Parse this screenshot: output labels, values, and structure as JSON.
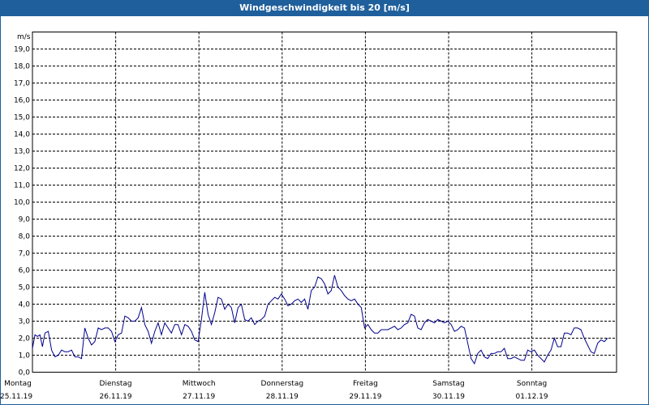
{
  "window": {
    "title_bar_color": "#1f5f9c"
  },
  "chart_data": {
    "type": "line",
    "title": "Windgeschwindigkeit bis 20 [m/s]",
    "ylabel": "m/s",
    "ylim": [
      0,
      20
    ],
    "yticks": [
      "0,0",
      "1,0",
      "2,0",
      "3,0",
      "4,0",
      "5,0",
      "6,0",
      "7,0",
      "8,0",
      "9,0",
      "10,0",
      "11,0",
      "12,0",
      "13,0",
      "14,0",
      "15,0",
      "16,0",
      "17,0",
      "18,0",
      "19,0"
    ],
    "days": [
      {
        "name": "Montag",
        "date": "25.11.19"
      },
      {
        "name": "Dienstag",
        "date": "26.11.19"
      },
      {
        "name": "Mittwoch",
        "date": "27.11.19"
      },
      {
        "name": "Donnerstag",
        "date": "28.11.19"
      },
      {
        "name": "Freitag",
        "date": "29.11.19"
      },
      {
        "name": "Samstag",
        "date": "30.11.19"
      },
      {
        "name": "Sonntag",
        "date": "01.12.19"
      }
    ],
    "grid": true,
    "line_color": "#00008b",
    "x_unit": "days since start of Montag 25.11.19",
    "points": [
      [
        0.0,
        1.4
      ],
      [
        0.03,
        2.2
      ],
      [
        0.06,
        2.1
      ],
      [
        0.09,
        2.2
      ],
      [
        0.12,
        1.5
      ],
      [
        0.15,
        2.3
      ],
      [
        0.19,
        2.4
      ],
      [
        0.23,
        1.3
      ],
      [
        0.27,
        0.9
      ],
      [
        0.31,
        1.0
      ],
      [
        0.35,
        1.3
      ],
      [
        0.39,
        1.2
      ],
      [
        0.43,
        1.2
      ],
      [
        0.47,
        1.3
      ],
      [
        0.51,
        0.9
      ],
      [
        0.55,
        0.9
      ],
      [
        0.59,
        0.8
      ],
      [
        0.63,
        2.6
      ],
      [
        0.67,
        2.0
      ],
      [
        0.71,
        1.6
      ],
      [
        0.75,
        1.8
      ],
      [
        0.79,
        2.6
      ],
      [
        0.83,
        2.5
      ],
      [
        0.87,
        2.6
      ],
      [
        0.91,
        2.6
      ],
      [
        0.95,
        2.4
      ],
      [
        0.99,
        1.8
      ],
      [
        1.03,
        2.2
      ],
      [
        1.07,
        2.3
      ],
      [
        1.11,
        3.3
      ],
      [
        1.15,
        3.2
      ],
      [
        1.19,
        3.0
      ],
      [
        1.23,
        3.0
      ],
      [
        1.27,
        3.2
      ],
      [
        1.31,
        3.8
      ],
      [
        1.35,
        2.8
      ],
      [
        1.39,
        2.4
      ],
      [
        1.43,
        1.7
      ],
      [
        1.47,
        2.4
      ],
      [
        1.51,
        2.9
      ],
      [
        1.55,
        2.2
      ],
      [
        1.59,
        2.9
      ],
      [
        1.63,
        2.6
      ],
      [
        1.67,
        2.3
      ],
      [
        1.71,
        2.8
      ],
      [
        1.75,
        2.8
      ],
      [
        1.79,
        2.2
      ],
      [
        1.83,
        2.8
      ],
      [
        1.87,
        2.7
      ],
      [
        1.91,
        2.4
      ],
      [
        1.95,
        1.9
      ],
      [
        1.99,
        1.8
      ],
      [
        2.03,
        3.1
      ],
      [
        2.07,
        4.7
      ],
      [
        2.11,
        3.4
      ],
      [
        2.15,
        2.8
      ],
      [
        2.19,
        3.5
      ],
      [
        2.23,
        4.4
      ],
      [
        2.27,
        4.3
      ],
      [
        2.31,
        3.7
      ],
      [
        2.35,
        4.0
      ],
      [
        2.39,
        3.8
      ],
      [
        2.43,
        2.9
      ],
      [
        2.47,
        3.8
      ],
      [
        2.51,
        4.0
      ],
      [
        2.55,
        3.1
      ],
      [
        2.59,
        3.0
      ],
      [
        2.63,
        3.2
      ],
      [
        2.67,
        2.8
      ],
      [
        2.71,
        3.0
      ],
      [
        2.75,
        3.1
      ],
      [
        2.79,
        3.3
      ],
      [
        2.83,
        4.0
      ],
      [
        2.87,
        4.2
      ],
      [
        2.91,
        4.4
      ],
      [
        2.95,
        4.3
      ],
      [
        2.99,
        4.6
      ],
      [
        3.03,
        4.3
      ],
      [
        3.07,
        3.9
      ],
      [
        3.11,
        4.0
      ],
      [
        3.15,
        4.2
      ],
      [
        3.19,
        4.3
      ],
      [
        3.23,
        4.1
      ],
      [
        3.27,
        4.3
      ],
      [
        3.31,
        3.7
      ],
      [
        3.35,
        4.8
      ],
      [
        3.39,
        5.0
      ],
      [
        3.43,
        5.6
      ],
      [
        3.47,
        5.5
      ],
      [
        3.51,
        5.2
      ],
      [
        3.55,
        4.6
      ],
      [
        3.59,
        4.8
      ],
      [
        3.63,
        5.7
      ],
      [
        3.67,
        5.0
      ],
      [
        3.71,
        4.8
      ],
      [
        3.75,
        4.5
      ],
      [
        3.79,
        4.3
      ],
      [
        3.83,
        4.2
      ],
      [
        3.87,
        4.3
      ],
      [
        3.91,
        4.0
      ],
      [
        3.95,
        3.8
      ],
      [
        3.99,
        2.6
      ],
      [
        4.03,
        2.8
      ],
      [
        4.07,
        2.5
      ],
      [
        4.11,
        2.3
      ],
      [
        4.15,
        2.3
      ],
      [
        4.19,
        2.5
      ],
      [
        4.23,
        2.5
      ],
      [
        4.27,
        2.5
      ],
      [
        4.31,
        2.6
      ],
      [
        4.35,
        2.7
      ],
      [
        4.39,
        2.5
      ],
      [
        4.43,
        2.6
      ],
      [
        4.47,
        2.8
      ],
      [
        4.51,
        2.9
      ],
      [
        4.55,
        3.4
      ],
      [
        4.59,
        3.3
      ],
      [
        4.63,
        2.6
      ],
      [
        4.67,
        2.5
      ],
      [
        4.71,
        2.9
      ],
      [
        4.75,
        3.1
      ],
      [
        4.79,
        3.0
      ],
      [
        4.83,
        2.9
      ],
      [
        4.87,
        3.1
      ],
      [
        4.91,
        3.0
      ],
      [
        4.95,
        2.9
      ],
      [
        4.99,
        3.0
      ],
      [
        5.03,
        2.8
      ],
      [
        5.07,
        2.4
      ],
      [
        5.11,
        2.5
      ],
      [
        5.15,
        2.7
      ],
      [
        5.19,
        2.6
      ],
      [
        5.23,
        1.7
      ],
      [
        5.27,
        0.8
      ],
      [
        5.31,
        0.5
      ],
      [
        5.35,
        1.1
      ],
      [
        5.39,
        1.3
      ],
      [
        5.43,
        0.9
      ],
      [
        5.47,
        0.8
      ],
      [
        5.51,
        1.1
      ],
      [
        5.55,
        1.1
      ],
      [
        5.59,
        1.2
      ],
      [
        5.63,
        1.2
      ],
      [
        5.67,
        1.4
      ],
      [
        5.71,
        0.8
      ],
      [
        5.75,
        0.8
      ],
      [
        5.79,
        0.9
      ],
      [
        5.83,
        0.8
      ],
      [
        5.87,
        0.7
      ],
      [
        5.91,
        0.7
      ],
      [
        5.95,
        1.3
      ],
      [
        5.99,
        1.2
      ],
      [
        6.03,
        1.3
      ],
      [
        6.07,
        1.0
      ],
      [
        6.11,
        0.8
      ],
      [
        6.15,
        0.6
      ],
      [
        6.19,
        1.0
      ],
      [
        6.23,
        1.3
      ],
      [
        6.27,
        2.0
      ],
      [
        6.31,
        1.5
      ],
      [
        6.35,
        1.5
      ],
      [
        6.39,
        2.3
      ],
      [
        6.43,
        2.3
      ],
      [
        6.47,
        2.2
      ],
      [
        6.51,
        2.6
      ],
      [
        6.55,
        2.6
      ],
      [
        6.59,
        2.5
      ],
      [
        6.63,
        2.0
      ],
      [
        6.67,
        1.6
      ],
      [
        6.71,
        1.2
      ],
      [
        6.75,
        1.1
      ],
      [
        6.79,
        1.7
      ],
      [
        6.83,
        1.9
      ],
      [
        6.87,
        1.8
      ],
      [
        6.91,
        2.0
      ]
    ]
  }
}
